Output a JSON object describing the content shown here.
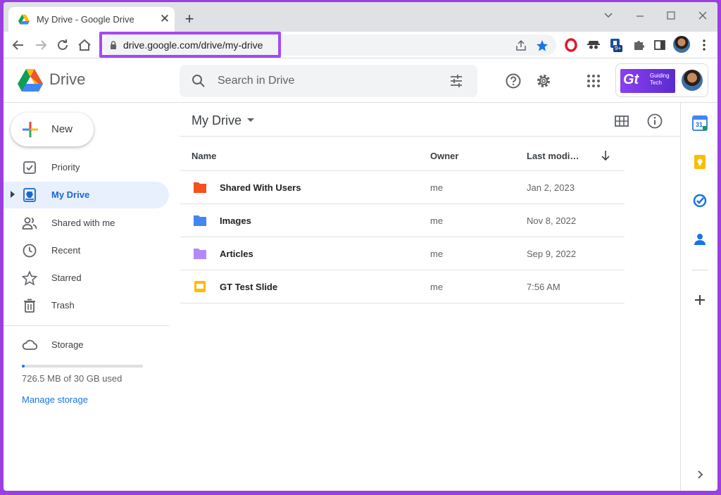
{
  "browser": {
    "tab_title": "My Drive - Google Drive",
    "tab_close": "✕",
    "new_tab": "+",
    "url": "drive.google.com/drive/my-drive",
    "extension_badge": "9+"
  },
  "header": {
    "app_name": "Drive",
    "search_placeholder": "Search in Drive",
    "brand_mark": "Gt",
    "brand_line1": "Guiding",
    "brand_line2": "Tech"
  },
  "sidebar": {
    "new_label": "New",
    "items": [
      {
        "label": "Priority",
        "icon": "priority-icon"
      },
      {
        "label": "My Drive",
        "icon": "my-drive-icon",
        "active": true
      },
      {
        "label": "Shared with me",
        "icon": "shared-icon"
      },
      {
        "label": "Recent",
        "icon": "clock-icon"
      },
      {
        "label": "Starred",
        "icon": "star-icon"
      },
      {
        "label": "Trash",
        "icon": "trash-icon"
      }
    ],
    "storage_label": "Storage",
    "storage_used_fraction": 0.024,
    "storage_text": "726.5 MB of 30 GB used",
    "manage_storage": "Manage storage"
  },
  "main": {
    "title": "My Drive",
    "columns": {
      "name": "Name",
      "owner": "Owner",
      "modified": "Last modi…"
    },
    "rows": [
      {
        "name": "Shared With Users",
        "owner": "me",
        "modified": "Jan 2, 2023",
        "type": "folder",
        "color": "#f4511e"
      },
      {
        "name": "Images",
        "owner": "me",
        "modified": "Nov 8, 2022",
        "type": "folder",
        "color": "#4285f4"
      },
      {
        "name": "Articles",
        "owner": "me",
        "modified": "Sep 9, 2022",
        "type": "folder",
        "color": "#b388f8"
      },
      {
        "name": "GT Test Slide",
        "owner": "me",
        "modified": "7:56 AM",
        "type": "slides",
        "color": "#fbbc04"
      }
    ]
  },
  "sidepanel": {
    "calendar_day": "31"
  },
  "colors": {
    "accent": "#1a73e8",
    "active_bg": "#e8f0fe",
    "highlight": "#a24bf0"
  }
}
